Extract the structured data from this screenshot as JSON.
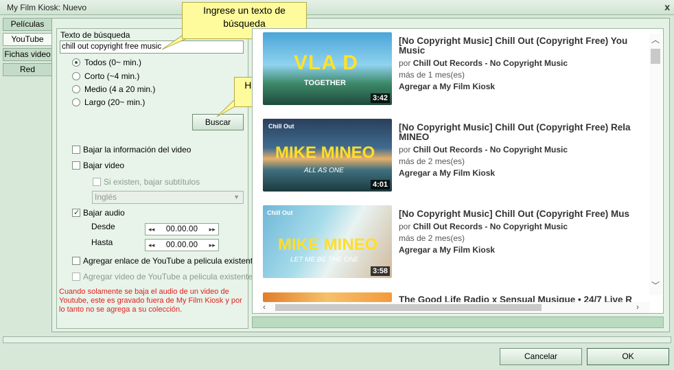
{
  "window": {
    "title": "My Film Kiosk: Nuevo",
    "close_label": "x"
  },
  "tabs": [
    {
      "label": "Películas"
    },
    {
      "label": "YouTube"
    },
    {
      "label": "Fichas video"
    },
    {
      "label": "Red"
    }
  ],
  "search": {
    "label": "Texto de búsqueda",
    "value": "chill out copyright free music",
    "durations": [
      "Todos (0~ min.)",
      "Corto (~4 min.)",
      "Medio (4 a 20 min.)",
      "Largo (20~ min.)"
    ],
    "selected_duration": "Todos (0~ min.)",
    "button_label": "Buscar"
  },
  "options": {
    "download_info": "Bajar la información del video",
    "download_video": "Bajar video",
    "subtitles": "Si existen, bajar subtítulos",
    "language": "Inglés",
    "download_audio": "Bajar audio",
    "from_label": "Desde",
    "from_value": "00.00.00",
    "to_label": "Hasta",
    "to_value": "00.00.00",
    "add_link": "Agregar enlace de YouTube a pelicula existente",
    "add_video": "Agregar video de YouTube a pelicula existente",
    "note": "Cuando solamente se baja el audio de un video de Youtube, este es gravado fuera de My Film Kiosk y por lo tanto no se agrega a su colección."
  },
  "callouts": {
    "search_hint": "Ingrese un texto de búsqueda",
    "click_hint": "Haga clic para buscar"
  },
  "results": [
    {
      "title_line1": "[No Copyright Music] Chill Out (Copyright Free) You",
      "title_line2": "Music",
      "by": "por",
      "channel": "Chill Out Records - No Copyright Music",
      "age": "más de 1 mes(es)",
      "add": "Agregar a My Film Kiosk",
      "duration": "3:42",
      "thumb_text": "VLA D",
      "thumb_sub": "TOGETHER"
    },
    {
      "title_line1": "[No Copyright Music] Chill Out (Copyright Free) Rela",
      "title_line2": "MINEO",
      "by": "por",
      "channel": "Chill Out Records - No Copyright Music",
      "age": "más de 2 mes(es)",
      "add": "Agregar a My Film Kiosk",
      "duration": "4:01",
      "thumb_text": "MIKE MINEO",
      "thumb_sub": "ALL AS ONE"
    },
    {
      "title_line1": "[No Copyright Music] Chill Out (Copyright Free) Mus",
      "by": "por",
      "channel": "Chill Out Records - No Copyright Music",
      "age": "más de 2 mes(es)",
      "add": "Agregar a My Film Kiosk",
      "duration": "3:58",
      "thumb_text": "MIKE MINEO",
      "thumb_sub": "LET ME BE THE ONE"
    },
    {
      "title_line1": "The Good Life Radio x Sensual Musique • 24/7 Live R"
    }
  ],
  "buttons": {
    "cancel": "Cancelar",
    "ok": "OK"
  },
  "colors": {
    "accent": "#d7e8d9",
    "callout": "#fdfb9c",
    "note": "#e02020"
  }
}
